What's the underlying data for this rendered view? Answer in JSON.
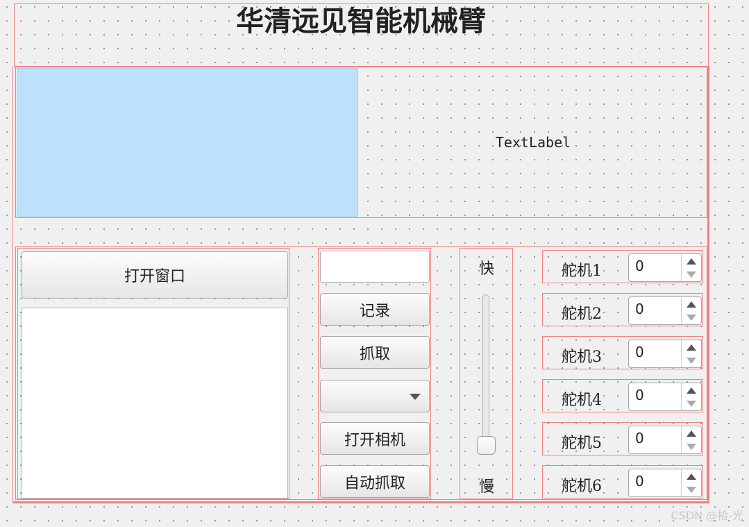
{
  "title": "华清远见智能机械臂",
  "video": {
    "label": "TextLabel"
  },
  "left_panel": {
    "open_window_button": "打开窗口"
  },
  "controls": {
    "input_value": "",
    "record_button": "记录",
    "grab_button": "抓取",
    "combo_value": "",
    "open_camera_button": "打开相机",
    "auto_grab_button": "自动抓取"
  },
  "speed": {
    "fast_label": "快",
    "slow_label": "慢",
    "value_fraction": 0.0
  },
  "servos": [
    {
      "label": "舵机1",
      "value": "0"
    },
    {
      "label": "舵机2",
      "value": "0"
    },
    {
      "label": "舵机3",
      "value": "0"
    },
    {
      "label": "舵机4",
      "value": "0"
    },
    {
      "label": "舵机5",
      "value": "0"
    },
    {
      "label": "舵机6",
      "value": "0"
    }
  ],
  "watermark": "CSDN @拾-光",
  "colors": {
    "layout_border": "#f08080",
    "camera_view": "#bde0fb",
    "background": "#f0f0f0"
  }
}
